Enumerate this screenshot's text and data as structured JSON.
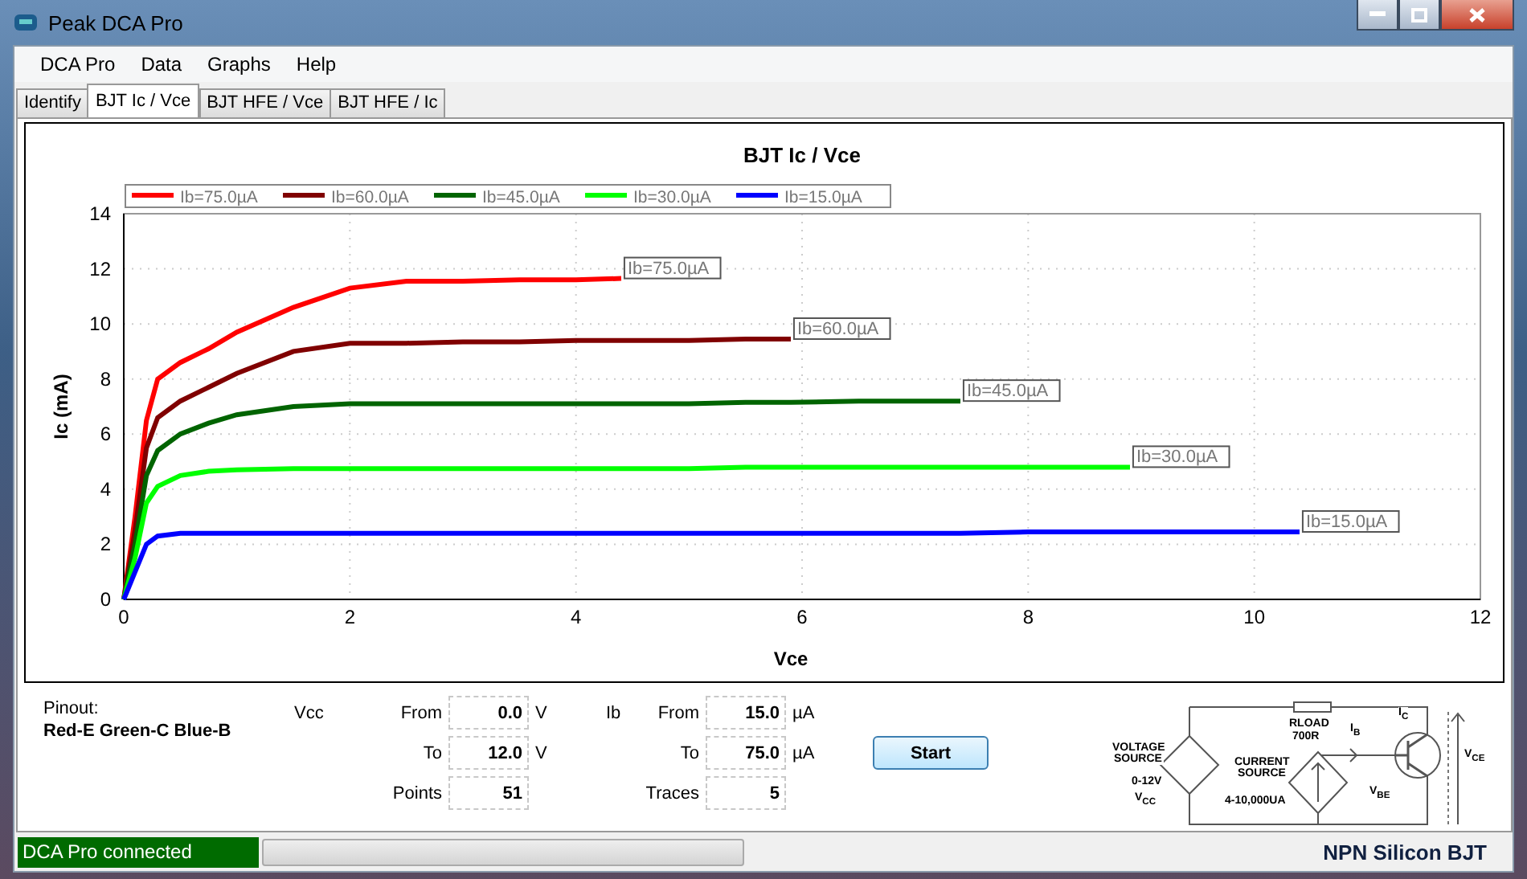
{
  "window": {
    "title": "Peak DCA Pro"
  },
  "menu": [
    "DCA Pro",
    "Data",
    "Graphs",
    "Help"
  ],
  "tabs": [
    {
      "label": "Identify",
      "selected": false
    },
    {
      "label": "BJT Ic / Vce",
      "selected": true
    },
    {
      "label": "BJT HFE / Vce",
      "selected": false
    },
    {
      "label": "BJT HFE / Ic",
      "selected": false
    }
  ],
  "chart_data": {
    "type": "line",
    "title": "BJT Ic / Vce",
    "xlabel": "Vce",
    "ylabel": "Ic (mA)",
    "x": [
      0,
      0.1,
      0.2,
      0.3,
      0.5,
      0.75,
      1,
      1.5,
      2,
      2.5,
      3,
      3.5,
      4,
      4.4,
      5,
      5.5,
      5.9,
      6.5,
      7,
      7.4,
      8,
      8.5,
      8.9,
      9.5,
      10,
      10.4
    ],
    "series": [
      {
        "name": "Ib=75.0µA",
        "color": "#ff0000",
        "values": [
          0,
          3,
          6.5,
          8,
          8.6,
          9.1,
          9.7,
          10.6,
          11.3,
          11.55,
          11.55,
          11.6,
          11.6,
          11.65,
          null,
          null,
          null,
          null,
          null,
          null,
          null,
          null,
          null,
          null,
          null,
          null
        ]
      },
      {
        "name": "Ib=60.0µA",
        "color": "#800000",
        "values": [
          0,
          2.5,
          5.5,
          6.6,
          7.2,
          7.7,
          8.2,
          9,
          9.3,
          9.3,
          9.35,
          9.35,
          9.4,
          9.4,
          9.4,
          9.45,
          9.45,
          null,
          null,
          null,
          null,
          null,
          null,
          null,
          null,
          null
        ]
      },
      {
        "name": "Ib=45.0µA",
        "color": "#006400",
        "values": [
          0,
          2,
          4.5,
          5.4,
          6,
          6.4,
          6.7,
          7,
          7.1,
          7.1,
          7.1,
          7.1,
          7.1,
          7.1,
          7.1,
          7.15,
          7.15,
          7.2,
          7.2,
          7.2,
          null,
          null,
          null,
          null,
          null,
          null
        ]
      },
      {
        "name": "Ib=30.0µA",
        "color": "#00ff00",
        "values": [
          0,
          1.5,
          3.5,
          4.1,
          4.5,
          4.65,
          4.7,
          4.75,
          4.75,
          4.75,
          4.75,
          4.75,
          4.75,
          4.75,
          4.75,
          4.8,
          4.8,
          4.8,
          4.8,
          4.8,
          4.8,
          4.8,
          4.8,
          null,
          null,
          null
        ]
      },
      {
        "name": "Ib=15.0µA",
        "color": "#0000ff",
        "values": [
          0,
          1,
          2,
          2.3,
          2.4,
          2.4,
          2.4,
          2.4,
          2.4,
          2.4,
          2.4,
          2.4,
          2.4,
          2.4,
          2.4,
          2.4,
          2.4,
          2.4,
          2.4,
          2.4,
          2.45,
          2.45,
          2.45,
          2.45,
          2.45,
          2.45
        ]
      }
    ],
    "grid": true,
    "legend": true,
    "xlim": [
      0,
      12
    ],
    "ylim": [
      0,
      14
    ],
    "xticks": [
      0,
      2,
      4,
      6,
      8,
      10,
      12
    ],
    "yticks": [
      0,
      2,
      4,
      6,
      8,
      10,
      12,
      14
    ],
    "annotations": [
      {
        "text": "Ib=75.0µA",
        "x": 4.4,
        "y": 11.65
      },
      {
        "text": "Ib=60.0µA",
        "x": 5.9,
        "y": 9.45
      },
      {
        "text": "Ib=45.0µA",
        "x": 7.4,
        "y": 7.2
      },
      {
        "text": "Ib=30.0µA",
        "x": 8.9,
        "y": 4.8
      },
      {
        "text": "Ib=15.0µA",
        "x": 10.4,
        "y": 2.45
      }
    ]
  },
  "pinout": {
    "label": "Pinout:",
    "value": "Red-E Green-C Blue-B"
  },
  "vcc": {
    "label": "Vcc",
    "from_label": "From",
    "from": "0.0",
    "to_label": "To",
    "to": "12.0",
    "unit_from": "V",
    "unit_to": "V",
    "points_label": "Points",
    "points": "51"
  },
  "ib": {
    "label": "Ib",
    "from_label": "From",
    "from": "15.0",
    "to_label": "To",
    "to": "75.0",
    "unit_from": "µA",
    "unit_to": "µA",
    "traces_label": "Traces",
    "traces": "5"
  },
  "start_button": "Start",
  "schematic": {
    "labels": [
      {
        "text": "VOLTAGE SOURCE"
      },
      {
        "text": "0-12V"
      },
      {
        "text": "V$_{CC}$"
      },
      {
        "text": "RLOAD"
      },
      {
        "text": "700R"
      },
      {
        "text": "I$_{B}$"
      },
      {
        "text": "CURRENT SOURCE"
      },
      {
        "text": "4-10,000UA"
      },
      {
        "text": "I$_{C}$"
      },
      {
        "text": "V$_{BE}$"
      },
      {
        "text": "V$_{CE}$"
      }
    ]
  },
  "status_bar": {
    "connection": "DCA Pro connected",
    "progress": {
      "level": 0
    },
    "device": "NPN Silicon BJT"
  }
}
